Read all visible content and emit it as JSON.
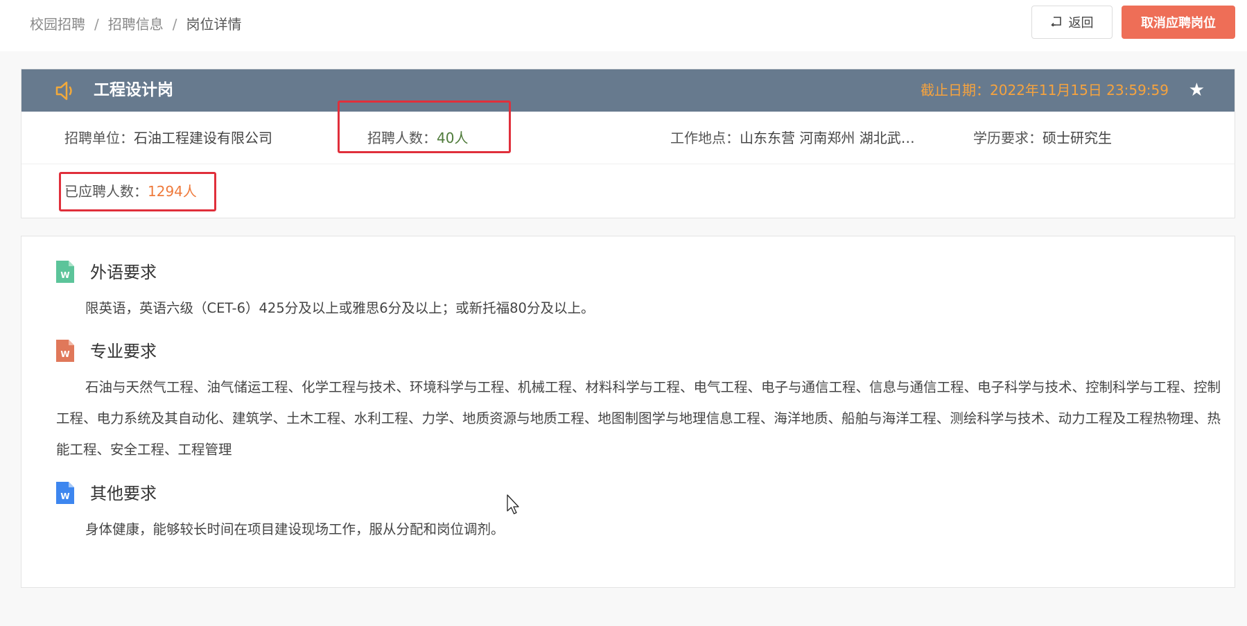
{
  "breadcrumb": {
    "items": [
      "校园招聘",
      "招聘信息",
      "岗位详情"
    ],
    "separator": "/"
  },
  "toolbar": {
    "back_label": "返回",
    "cancel_label": "取消应聘岗位"
  },
  "job": {
    "title": "工程设计岗",
    "deadline_label": "截止日期：",
    "deadline_value": "2022年11月15日 23:59:59",
    "fields": {
      "unit_label": "招聘单位：",
      "unit_value": "石油工程建设有限公司",
      "headcount_label": "招聘人数：",
      "headcount_value": "40人",
      "location_label": "工作地点：",
      "location_value": "山东东营 河南郑州 湖北武…",
      "education_label": "学历要求：",
      "education_value": "硕士研究生",
      "applied_label": "已应聘人数：",
      "applied_value": "1294人"
    }
  },
  "requirements": [
    {
      "title": "外语要求",
      "icon": "word-doc-icon",
      "color": "#5cc49a",
      "text": "限英语，英语六级（CET-6）425分及以上或雅思6分及以上；或新托福80分及以上。"
    },
    {
      "title": "专业要求",
      "icon": "word-doc-icon",
      "color": "#e0785a",
      "text": "石油与天然气工程、油气储运工程、化学工程与技术、环境科学与工程、机械工程、材料科学与工程、电气工程、电子与通信工程、信息与通信工程、电子科学与技术、控制科学与工程、控制工程、电力系统及其自动化、建筑学、土木工程、水利工程、力学、地质资源与地质工程、地图制图学与地理信息工程、海洋地质、船舶与海洋工程、测绘科学与技术、动力工程及工程热物理、热能工程、安全工程、工程管理"
    },
    {
      "title": "其他要求",
      "icon": "word-doc-icon",
      "color": "#3d86ef",
      "text": "身体健康，能够较长时间在项目建设现场工作，服从分配和岗位调剂。"
    }
  ],
  "colors": {
    "header_bg": "#677a8e",
    "deadline": "#f6a33e",
    "cancel_button": "#ee6e57",
    "highlight_box": "#e02f3b",
    "headcount": "#4f7b3b",
    "applied_count": "#ee7a3c"
  }
}
